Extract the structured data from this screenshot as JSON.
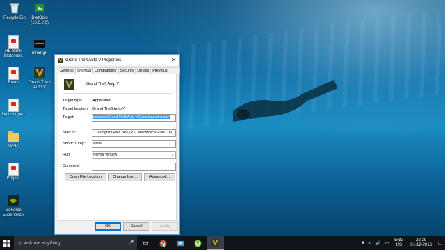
{
  "desktop": {
    "icons": [
      {
        "label": "Recycle Bin",
        "icon": "recycle-bin-icon"
      },
      {
        "label": "DietOdin (10.0.2.0)",
        "icon": "dietodin-icon"
      },
      {
        "label": "RB Bank Statement",
        "icon": "pdf-icon"
      },
      {
        "label": "mn6Cgk",
        "icon": "file-icon"
      },
      {
        "label": "Exam",
        "icon": "pdf-icon"
      },
      {
        "label": "Grand Theft Auto V",
        "icon": "gta-icon"
      },
      {
        "label": "Do not open",
        "icon": "pdf-icon"
      },
      {
        "label": "WSP",
        "icon": "folder-icon"
      },
      {
        "label": "Project",
        "icon": "pdf-icon"
      },
      {
        "label": "GeForce Experience",
        "icon": "geforce-icon"
      }
    ]
  },
  "dialog": {
    "title": "Grand Theft Auto V Properties",
    "close_symbol": "✕",
    "tabs": [
      "General",
      "Shortcut",
      "Compatibility",
      "Security",
      "Details",
      "Previous Versions"
    ],
    "active_tab": "Shortcut",
    "app_name": "Grand Theft Auto V",
    "target_type_label": "Target type:",
    "target_type_value": "Application",
    "target_location_label": "Target location:",
    "target_location_value": "Grand Theft Auto V",
    "target_label": "Target:",
    "target_value": "echanics\\Grand Theft Auto V\\GameLauncher.exe\"",
    "start_in_label": "Start in:",
    "start_in_value": "\"C:\\Program Files (x86)\\R.G. Mechanics\\Grand The",
    "shortcut_key_label": "Shortcut key:",
    "shortcut_key_value": "None",
    "run_label": "Run:",
    "run_value": "Normal window",
    "comment_label": "Comment:",
    "comment_value": "",
    "open_file_location": "Open File Location",
    "change_icon": "Change Icon...",
    "advanced": "Advanced...",
    "ok": "OK",
    "cancel": "Cancel",
    "apply": "Apply"
  },
  "taskbar": {
    "search_placeholder": "Ask me anything",
    "apps": [
      "task-view-icon",
      "chrome-icon",
      "installer-icon",
      "utorrent-icon",
      "gta-icon"
    ],
    "lang_top": "ENG",
    "lang_bottom": "US",
    "time": "22:29",
    "date": "01-12-2016"
  },
  "colors": {
    "accent": "#0078d7",
    "selection": "#3399ff",
    "taskbar": "#101418"
  }
}
